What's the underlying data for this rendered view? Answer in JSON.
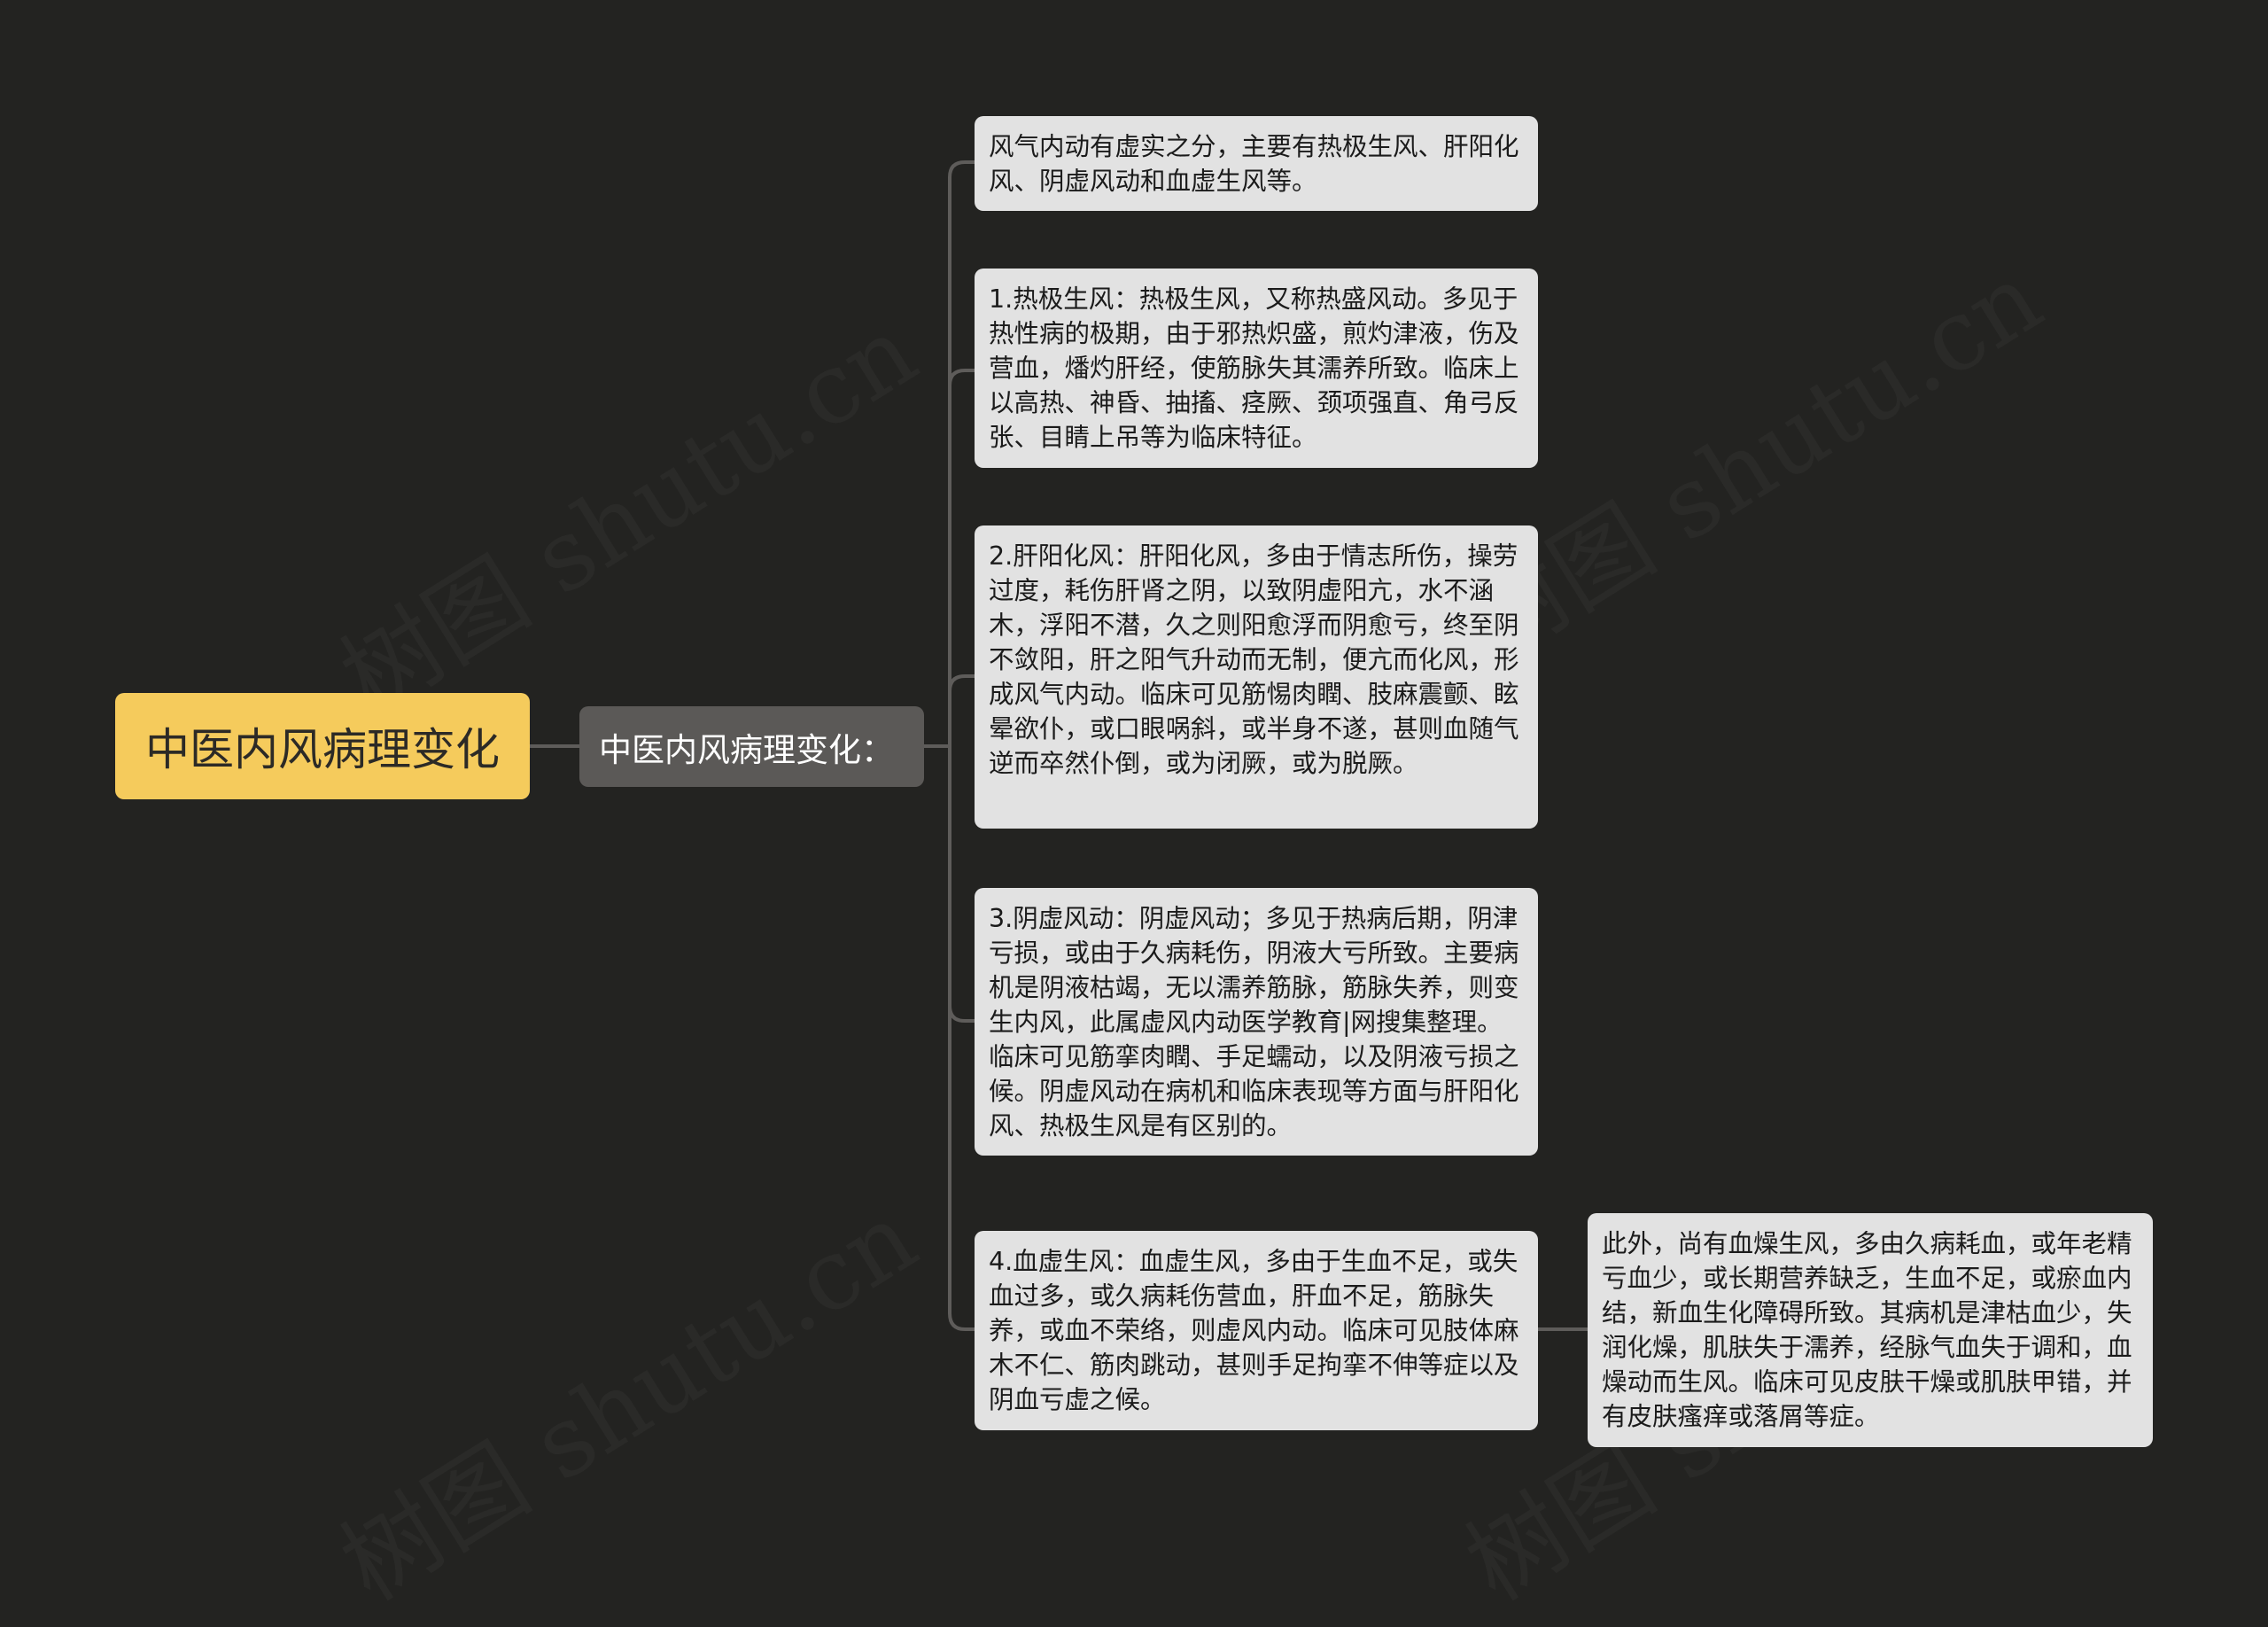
{
  "watermark": "树图 shutu.cn",
  "colors": {
    "background": "#232321",
    "root_fill": "#F5CB5C",
    "branch_fill": "#5B5957",
    "leaf_fill": "#E2E2E2",
    "connector": "#5E5C5A"
  },
  "mindmap": {
    "root": {
      "label": "中医内风病理变化"
    },
    "branch": {
      "label": "中医内风病理变化："
    },
    "leaves": [
      {
        "text": "风气内动有虚实之分，主要有热极生风、肝阳化风、阴虚风动和血虚生风等。"
      },
      {
        "text": "1.热极生风：热极生风，又称热盛风动。多见于热性病的极期，由于邪热炽盛，煎灼津液，伤及营血，燔灼肝经，使筋脉失其濡养所致。临床上以高热、神昏、抽搐、痉厥、颈项强直、角弓反张、目睛上吊等为临床特征。"
      },
      {
        "text": "2.肝阳化风：肝阳化风，多由于情志所伤，操劳过度，耗伤肝肾之阴，以致阴虚阳亢，水不涵木，浮阳不潜，久之则阳愈浮而阴愈亏，终至阴不敛阳，肝之阳气升动而无制，便亢而化风，形成风气内动。临床可见筋惕肉瞤、肢麻震颤、眩晕欲仆，或口眼㖞斜，或半身不遂，甚则血随气逆而卒然仆倒，或为闭厥，或为脱厥。"
      },
      {
        "text": "3.阴虚风动：阴虚风动；多见于热病后期，阴津亏损，或由于久病耗伤，阴液大亏所致。主要病机是阴液枯竭，无以濡养筋脉，筋脉失养，则变生内风，此属虚风内动医学教育|网搜集整理。临床可见筋挛肉瞤、手足蠕动，以及阴液亏损之候。阴虚风动在病机和临床表现等方面与肝阳化风、热极生风是有区别的。"
      },
      {
        "text": "4.血虚生风：血虚生风，多由于生血不足，或失血过多，或久病耗伤营血，肝血不足，筋脉失养，或血不荣络，则虚风内动。临床可见肢体麻木不仁、筋肉跳动，甚则手足拘挛不伸等症以及阴血亏虚之候。"
      }
    ],
    "sub_leaf": {
      "text": "此外，尚有血燥生风，多由久病耗血，或年老精亏血少，或长期营养缺乏，生血不足，或瘀血内结，新血生化障碍所致。其病机是津枯血少，失润化燥，肌肤失于濡养，经脉气血失于调和，血燥动而生风。临床可见皮肤干燥或肌肤甲错，并有皮肤瘙痒或落屑等症。"
    }
  }
}
